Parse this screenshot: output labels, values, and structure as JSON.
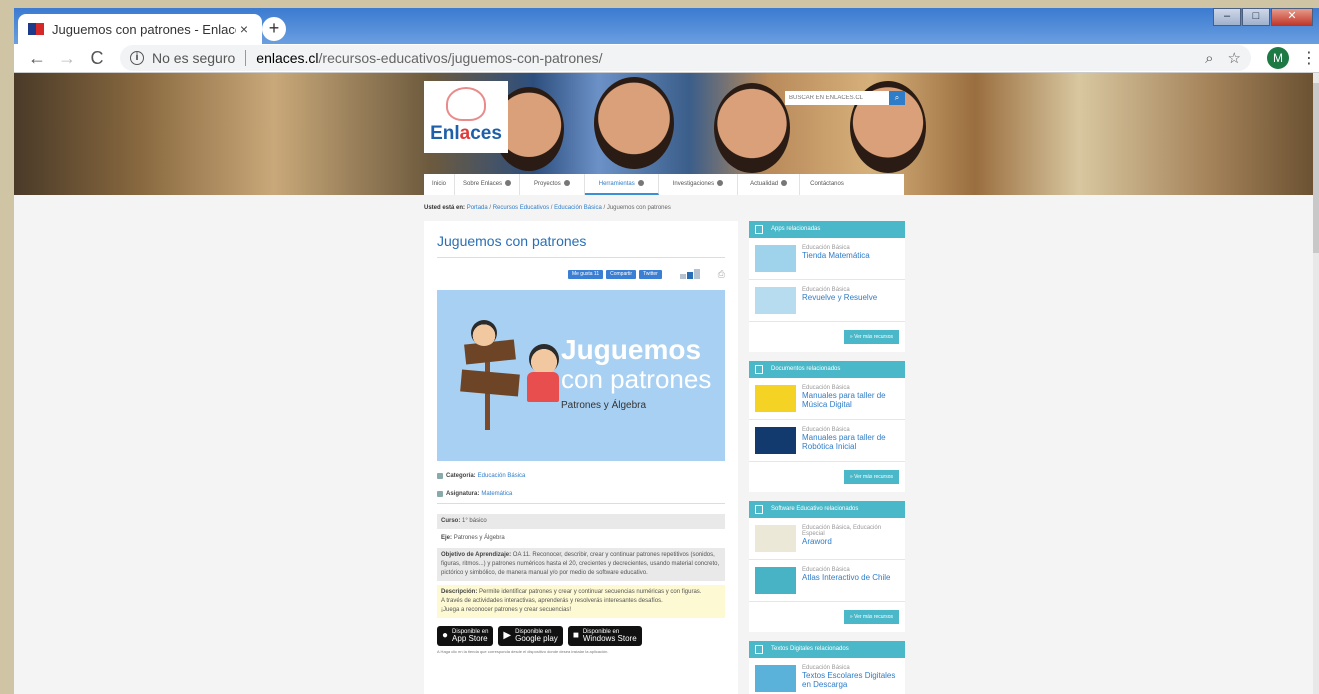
{
  "browser": {
    "tab_title": "Juguemos con patrones - Enlaces",
    "tab_close": "×",
    "new_tab": "+",
    "win_min": "–",
    "win_max": "□",
    "win_close": "✕",
    "security_label": "No es seguro",
    "url_host": "enlaces.cl",
    "url_path": "/recursos-educativos/juguemos-con-patrones/",
    "profile_initial": "M"
  },
  "site": {
    "logo_text_a": "Enl",
    "logo_text_b": "a",
    "logo_text_c": "ces",
    "search_placeholder": "BUSCAR EN ENLACES.CL",
    "nav": [
      "Inicio",
      "Sobre Enlaces",
      "Proyectos",
      "Herramientas",
      "Investigaciones",
      "Actualidad",
      "Contáctanos"
    ]
  },
  "breadcrumb": {
    "prefix": "Usted está en:",
    "items": [
      "Portada",
      "Recursos Educativos",
      "Educación Básica"
    ],
    "current": "Juguemos con patrones",
    "sep": "/"
  },
  "article": {
    "title": "Juguemos con patrones",
    "share": {
      "like": "Me gusta 11",
      "share": "Compartir",
      "twitter": "Twitter"
    },
    "banner": {
      "title1": "Juguemos",
      "title2": "con patrones",
      "subtitle": "Patrones y Álgebra"
    },
    "category_label": "Categoría:",
    "category_value": "Educación Básica",
    "subject_label": "Asignatura:",
    "subject_value": "Matemática",
    "course_label": "Curso:",
    "course_value": "1° básico",
    "axis_label": "Eje:",
    "axis_value": "Patrones y Álgebra",
    "objective_label": "Objetivo de Aprendizaje:",
    "objective_value": "OA 11. Reconocer, describir, crear y continuar patrones repetitivos (sonidos, figuras, ritmos...) y patrones numéricos hasta el 20, crecientes y decrecientes, usando material concreto, pictórico y simbólico, de manera manual y/o por medio de software educativo.",
    "description_label": "Descripción:",
    "description_value": "Permite identificar patrones y crear y continuar secuencias numéricas y con figuras.",
    "description_line2": "A través de actividades interactivas, aprenderás y resolverás interesantes desafíos.",
    "description_line3": "¡Juega a reconocer patrones y crear secuencias!",
    "stores": [
      {
        "small": "Disponible en",
        "big": "App Store"
      },
      {
        "small": "Disponible en",
        "big": "Google play"
      },
      {
        "small": "Disponible en",
        "big": "Windows Store"
      }
    ],
    "fine_print": "A Haga clic en la tienda que corresponda desde el dispositivo donde desea instalar la aplicación."
  },
  "sidebar": {
    "panels": [
      {
        "title": "Apps relacionadas",
        "items": [
          {
            "type": "Educación Básica",
            "title": "Tienda Matemática"
          },
          {
            "type": "Educación Básica",
            "title": "Revuelve y Resuelve"
          }
        ],
        "more": "» Ver más recursos"
      },
      {
        "title": "Documentos relacionados",
        "items": [
          {
            "type": "Educación Básica",
            "title": "Manuales para taller de Música Digital"
          },
          {
            "type": "Educación Básica",
            "title": "Manuales para taller de Robótica Inicial"
          }
        ],
        "more": "» Ver más recursos"
      },
      {
        "title": "Software Educativo relacionados",
        "items": [
          {
            "type": "Educación Básica, Educación Especial",
            "title": "Araword"
          },
          {
            "type": "Educación Básica",
            "title": "Atlas Interactivo de Chile"
          }
        ],
        "more": "» Ver más recursos"
      },
      {
        "title": "Textos Digitales relacionados",
        "items": [
          {
            "type": "Educación Básica",
            "title": "Textos Escolares Digitales en Descarga"
          }
        ]
      }
    ]
  },
  "colors": {
    "accent": "#4ab8c8",
    "link": "#2f7dc9",
    "chrome_blue": "#3b7ad0"
  }
}
